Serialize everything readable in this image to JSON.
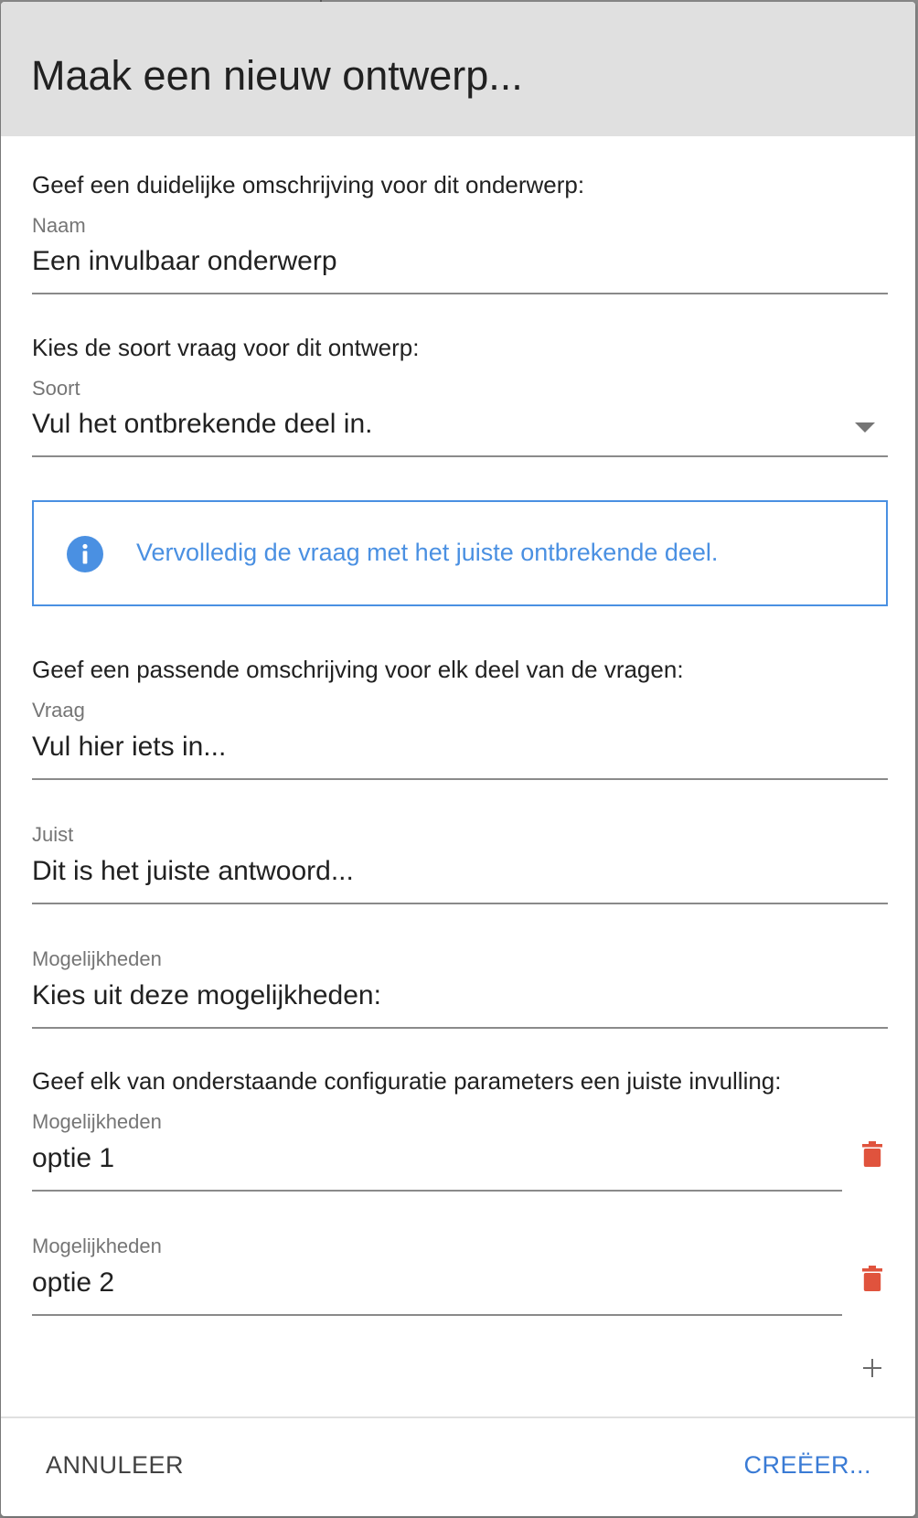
{
  "dialog": {
    "title": "Maak een nieuw ontwerp..."
  },
  "name_section": {
    "instruction": "Geef een duidelijke omschrijving voor dit onderwerp:",
    "label": "Naam",
    "value": "Een invulbaar onderwerp"
  },
  "type_section": {
    "instruction": "Kies de soort vraag voor dit ontwerp:",
    "label": "Soort",
    "value": "Vul het ontbrekende deel in.",
    "dropdown_icon": "arrow-drop-down"
  },
  "info": {
    "icon": "info-circle",
    "text": "Vervolledig de vraag met het juiste ontbrekende deel.",
    "color": "#4a90e2"
  },
  "parts_section": {
    "instruction": "Geef een passende omschrijving voor elk deel van de vragen:",
    "fields": [
      {
        "label": "Vraag",
        "value": "Vul hier iets in..."
      },
      {
        "label": "Juist",
        "value": "Dit is het juiste antwoord..."
      },
      {
        "label": "Mogelijkheden",
        "value": "Kies uit deze mogelijkheden:"
      }
    ]
  },
  "config_section": {
    "instruction": "Geef elk van onderstaande configuratie parameters een juiste invulling:",
    "options": [
      {
        "label": "Mogelijkheden",
        "value": "optie 1",
        "delete_icon": "trash"
      },
      {
        "label": "Mogelijkheden",
        "value": "optie 2",
        "delete_icon": "trash"
      }
    ],
    "add_icon": "plus"
  },
  "actions": {
    "cancel_label": "ANNULEER",
    "create_label": "CREËER...",
    "create_color": "#3a7bd5",
    "delete_color": "#e0533d"
  }
}
